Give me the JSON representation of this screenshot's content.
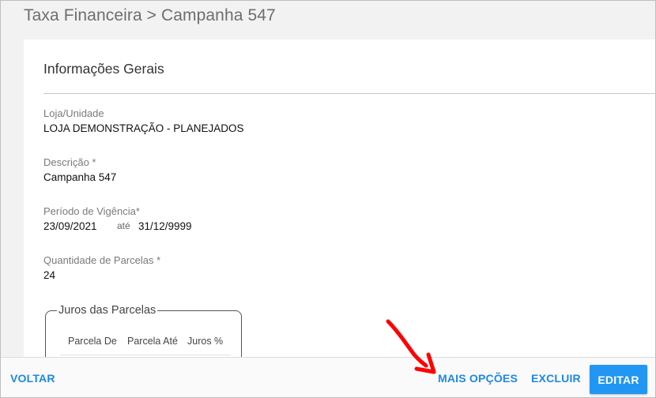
{
  "header": {
    "breadcrumb": "Taxa Financeira > Campanha 547"
  },
  "section": {
    "title": "Informações Gerais"
  },
  "fields": {
    "loja": {
      "label": "Loja/Unidade",
      "value": "LOJA DEMONSTRAÇÃO - PLANEJADOS"
    },
    "descricao": {
      "label": "Descrição *",
      "value": "Campanha 547"
    },
    "periodo": {
      "label": "Período de Vigência*",
      "start": "23/09/2021",
      "separator": "até",
      "end": "31/12/9999"
    },
    "parcelas": {
      "label": "Quantidade de Parcelas *",
      "value": "24"
    }
  },
  "juros": {
    "legend": "Juros das Parcelas",
    "columns": [
      "Parcela De",
      "Parcela Até",
      "Juros %"
    ]
  },
  "footer": {
    "voltar": "VOLTAR",
    "mais_opcoes": "MAIS OPÇÕES",
    "excluir": "EXCLUIR",
    "editar": "EDITAR"
  },
  "colors": {
    "accent": "#2196f3",
    "link": "#1e88e5",
    "annotation_arrow": "#ff0000"
  },
  "icons": {
    "annotation": "red-arrow-icon"
  }
}
